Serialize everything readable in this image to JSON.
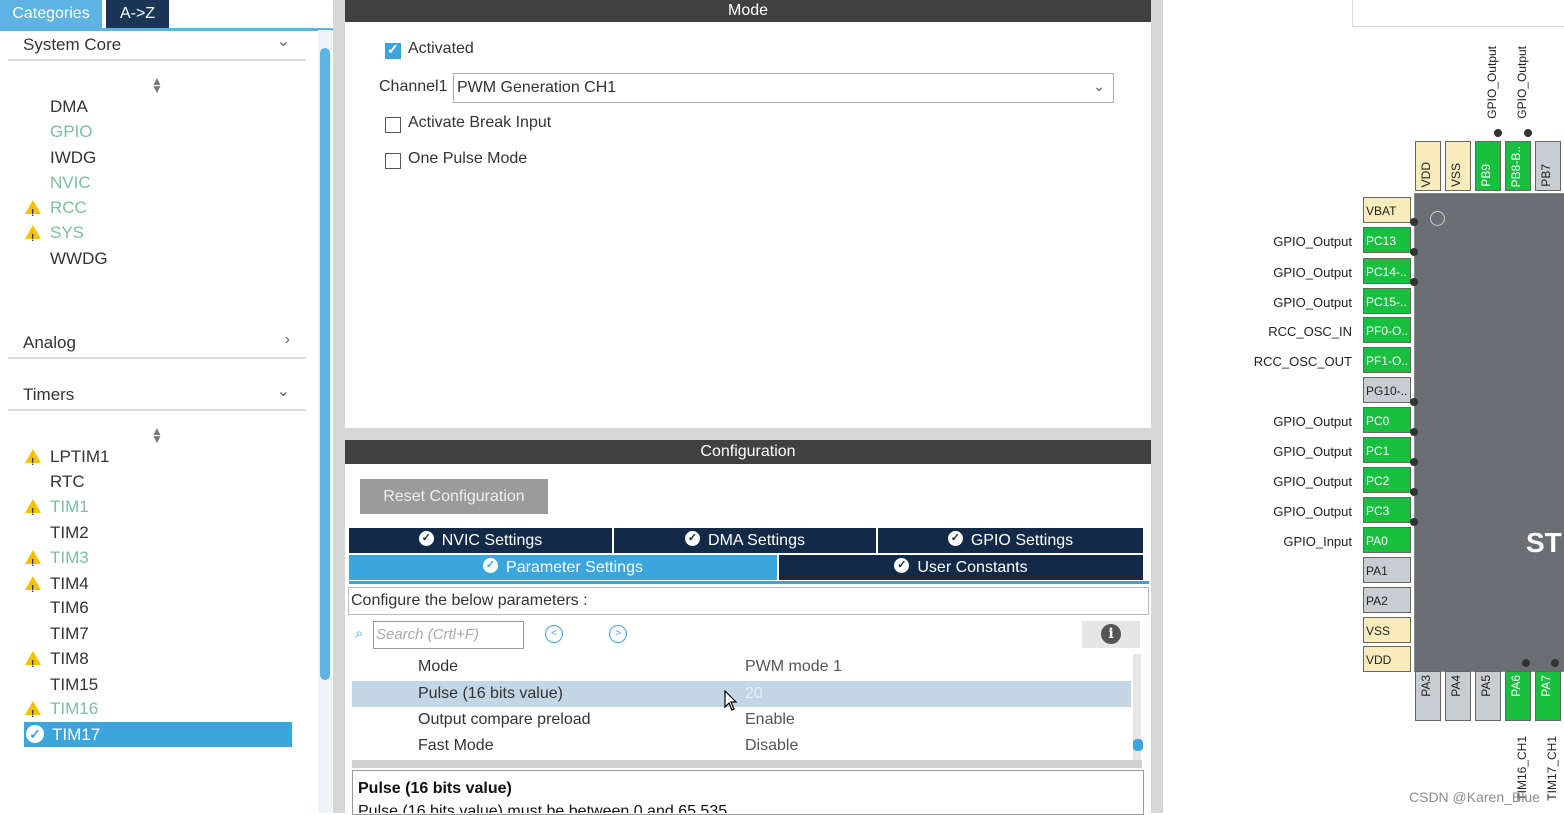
{
  "left": {
    "tabs": [
      "Categories",
      "A->Z"
    ],
    "categories": {
      "system_core": "System Core",
      "analog": "Analog",
      "timers": "Timers"
    },
    "system_core_items": [
      "DMA",
      "GPIO",
      "IWDG",
      "NVIC",
      "RCC",
      "SYS",
      "WWDG"
    ],
    "timer_items": [
      "LPTIM1",
      "RTC",
      "TIM1",
      "TIM2",
      "TIM3",
      "TIM4",
      "TIM6",
      "TIM7",
      "TIM8",
      "TIM15",
      "TIM16",
      "TIM17"
    ]
  },
  "mode": {
    "header": "Mode",
    "activated_label": "Activated",
    "activated": true,
    "channel1_label": "Channel1",
    "channel1_value": "PWM Generation CH1",
    "break_label": "Activate Break Input",
    "onepulse_label": "One Pulse Mode"
  },
  "config": {
    "header": "Configuration",
    "reset_label": "Reset Configuration",
    "tabs": {
      "nvic": "NVIC Settings",
      "dma": "DMA Settings",
      "gpio": "GPIO Settings",
      "param": "Parameter Settings",
      "user": "User Constants"
    },
    "desc": "Configure the below parameters :",
    "search_placeholder": "Search (Crtl+F)",
    "params": [
      {
        "key": "Mode",
        "value": "PWM mode 1"
      },
      {
        "key": "Pulse (16 bits value)",
        "value": "20"
      },
      {
        "key": "Output compare preload",
        "value": "Enable"
      },
      {
        "key": "Fast Mode",
        "value": "Disable"
      }
    ],
    "desc_title": "Pulse (16 bits value)",
    "desc_text": "Pulse (16 bits value) must be between 0 and 65 535"
  },
  "chip": {
    "left_pins": [
      {
        "pin": "VBAT",
        "label": ""
      },
      {
        "pin": "PC13",
        "label": "GPIO_Output"
      },
      {
        "pin": "PC14-..",
        "label": "GPIO_Output"
      },
      {
        "pin": "PC15-..",
        "label": "GPIO_Output"
      },
      {
        "pin": "PF0-O..",
        "label": "RCC_OSC_IN"
      },
      {
        "pin": "PF1-O..",
        "label": "RCC_OSC_OUT"
      },
      {
        "pin": "PG10-..",
        "label": ""
      },
      {
        "pin": "PC0",
        "label": "GPIO_Output"
      },
      {
        "pin": "PC1",
        "label": "GPIO_Output"
      },
      {
        "pin": "PC2",
        "label": "GPIO_Output"
      },
      {
        "pin": "PC3",
        "label": "GPIO_Output"
      },
      {
        "pin": "PA0",
        "label": "GPIO_Input"
      },
      {
        "pin": "PA1",
        "label": ""
      },
      {
        "pin": "PA2",
        "label": ""
      },
      {
        "pin": "VSS",
        "label": ""
      },
      {
        "pin": "VDD",
        "label": ""
      }
    ],
    "top_pins": [
      "VDD",
      "VSS",
      "PB9",
      "PB8-B..",
      "PB7"
    ],
    "top_labels": [
      "GPIO_Output",
      "GPIO_Output"
    ],
    "bottom_pins": [
      "PA3",
      "PA4",
      "PA5",
      "PA6",
      "PA7"
    ],
    "bottom_labels": [
      "TIM16_CH1",
      "TIM17_CH1"
    ],
    "logo": "ST",
    "colors": {
      "configured": "#19c040",
      "unused": "#c8cdd2",
      "power": "#f9ecbc"
    }
  },
  "watermark": "CSDN @Karen_Blue"
}
